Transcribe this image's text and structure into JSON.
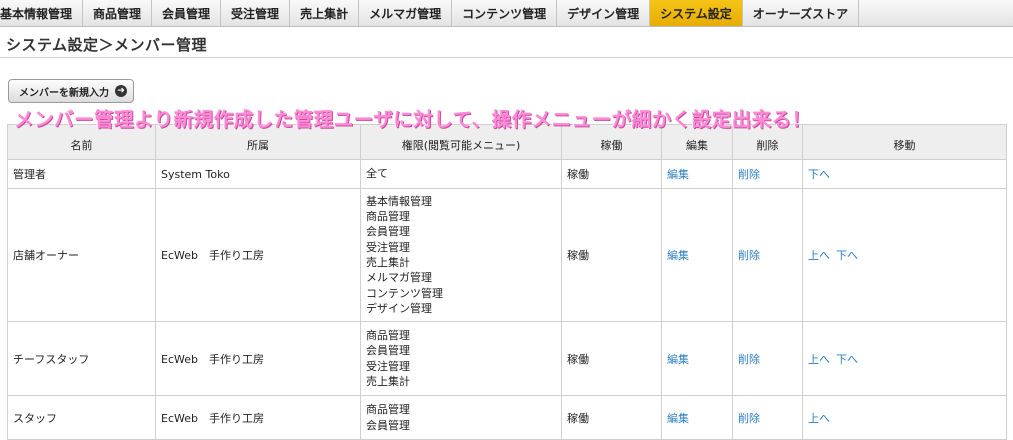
{
  "nav": {
    "items": [
      {
        "label": "基本情報管理",
        "active": false
      },
      {
        "label": "商品管理",
        "active": false
      },
      {
        "label": "会員管理",
        "active": false
      },
      {
        "label": "受注管理",
        "active": false
      },
      {
        "label": "売上集計",
        "active": false
      },
      {
        "label": "メルマガ管理",
        "active": false
      },
      {
        "label": "コンテンツ管理",
        "active": false
      },
      {
        "label": "デザイン管理",
        "active": false
      },
      {
        "label": "システム設定",
        "active": true
      },
      {
        "label": "オーナーズストア",
        "active": false
      }
    ]
  },
  "page": {
    "title": "システム設定＞メンバー管理",
    "add_button_label": "メンバーを新規入力",
    "caption": "メンバー管理より新規作成した管理ユーザに対して、操作メニューが細かく設定出来る！"
  },
  "table": {
    "headers": [
      "名前",
      "所属",
      "権限(閲覧可能メニュー)",
      "稼働",
      "編集",
      "削除",
      "移動"
    ],
    "rows": [
      {
        "name": "管理者",
        "affiliation": "System Toko",
        "permissions": [
          "全て"
        ],
        "status": "稼働",
        "edit": "編集",
        "delete": "削除",
        "move_up": "",
        "move_down": "下へ"
      },
      {
        "name": "店舗オーナー",
        "affiliation": "EcWeb　手作り工房",
        "permissions": [
          "基本情報管理",
          "商品管理",
          "会員管理",
          "受注管理",
          "売上集計",
          "メルマガ管理",
          "コンテンツ管理",
          "デザイン管理"
        ],
        "status": "稼働",
        "edit": "編集",
        "delete": "削除",
        "move_up": "上へ",
        "move_down": "下へ"
      },
      {
        "name": "チーフスタッフ",
        "affiliation": "EcWeb　手作り工房",
        "permissions": [
          "商品管理",
          "会員管理",
          "受注管理",
          "売上集計"
        ],
        "status": "稼働",
        "edit": "編集",
        "delete": "削除",
        "move_up": "上へ",
        "move_down": "下へ"
      },
      {
        "name": "スタッフ",
        "affiliation": "EcWeb　手作り工房",
        "permissions": [
          "商品管理",
          "会員管理"
        ],
        "status": "稼働",
        "edit": "編集",
        "delete": "削除",
        "move_up": "上へ",
        "move_down": ""
      }
    ]
  },
  "colors": {
    "active_tab": "#f0b90c",
    "link": "#2b7fc2",
    "caption": "#ff8ad6"
  },
  "icons": {
    "add_button_icon": "circle-arrow-right-icon"
  }
}
